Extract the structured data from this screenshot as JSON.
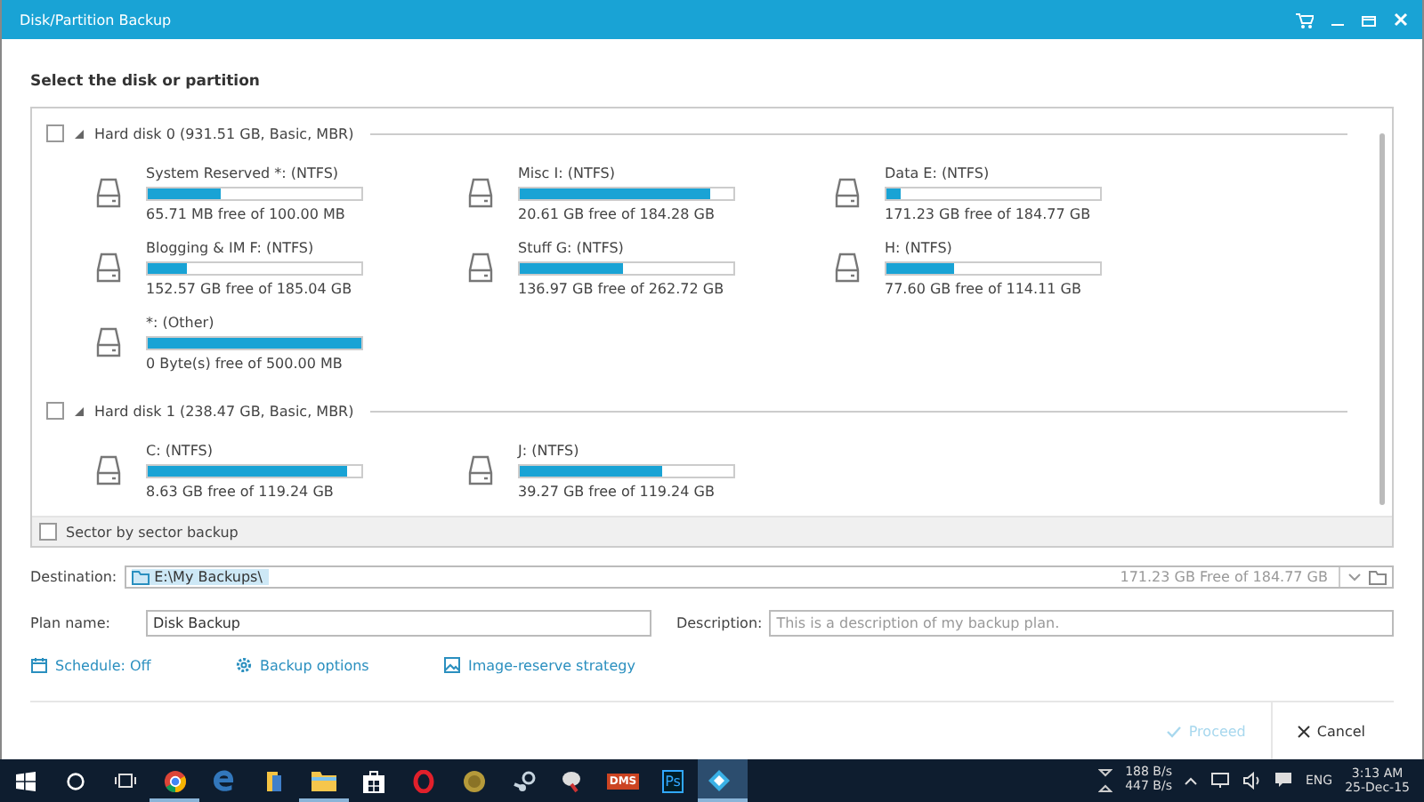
{
  "window": {
    "title": "Disk/Partition Backup"
  },
  "heading": "Select the disk or partition",
  "disks": [
    {
      "label": "Hard disk 0 (931.51 GB, Basic, MBR)",
      "checked": false,
      "expanded": true,
      "partitions": [
        {
          "name": "System Reserved *: (NTFS)",
          "level": 0.34,
          "free": "65.71 MB free of 100.00 MB"
        },
        {
          "name": "Misc I: (NTFS)",
          "level": 0.89,
          "free": "20.61 GB free of 184.28 GB"
        },
        {
          "name": "Data E: (NTFS)",
          "level": 0.07,
          "free": "171.23 GB free of 184.77 GB"
        },
        {
          "name": "Blogging & IM F: (NTFS)",
          "level": 0.18,
          "free": "152.57 GB free of 185.04 GB"
        },
        {
          "name": "Stuff G: (NTFS)",
          "level": 0.48,
          "free": "136.97 GB free of 262.72 GB"
        },
        {
          "name": "H: (NTFS)",
          "level": 0.32,
          "free": "77.60 GB free of 114.11 GB"
        },
        {
          "name": "*: (Other)",
          "level": 1.0,
          "free": "0 Byte(s) free of 500.00 MB"
        }
      ]
    },
    {
      "label": "Hard disk 1 (238.47 GB, Basic, MBR)",
      "checked": false,
      "expanded": true,
      "partitions": [
        {
          "name": "C: (NTFS)",
          "level": 0.93,
          "free": "8.63 GB free of 119.24 GB"
        },
        {
          "name": "J: (NTFS)",
          "level": 0.67,
          "free": "39.27 GB free of 119.24 GB"
        }
      ]
    }
  ],
  "sector_backup": {
    "label": "Sector by sector backup",
    "checked": false
  },
  "destination": {
    "label": "Destination:",
    "value": "E:\\My Backups\\",
    "free": "171.23 GB Free of 184.77 GB"
  },
  "plan_name": {
    "label": "Plan name:",
    "value": "Disk Backup"
  },
  "description": {
    "label": "Description:",
    "placeholder": "This is a description of my backup plan."
  },
  "links": [
    {
      "kind": "calendar",
      "label": "Schedule: Off"
    },
    {
      "kind": "gear",
      "label": "Backup options"
    },
    {
      "kind": "image",
      "label": "Image-reserve strategy"
    }
  ],
  "buttons": [
    {
      "label": "Proceed",
      "kind": "proceed",
      "disabled": true
    },
    {
      "label": "Cancel",
      "kind": "cancel",
      "disabled": false
    }
  ],
  "taskbar": {
    "items": [
      {
        "kind": "start",
        "open": false
      },
      {
        "kind": "search",
        "open": false
      },
      {
        "kind": "taskview",
        "open": false
      },
      {
        "kind": "chrome",
        "open": true
      },
      {
        "kind": "edge",
        "open": false
      },
      {
        "kind": "folder",
        "open": false
      },
      {
        "kind": "explorer",
        "open": true
      },
      {
        "kind": "store",
        "open": false
      },
      {
        "kind": "opera",
        "open": false
      },
      {
        "kind": "coin",
        "open": false
      },
      {
        "kind": "steam",
        "open": false
      },
      {
        "kind": "dish",
        "open": false
      },
      {
        "kind": "dms",
        "open": false,
        "label": "DMS"
      },
      {
        "kind": "ps",
        "open": false,
        "label": "Ps"
      },
      {
        "kind": "app",
        "open": true,
        "selected": true
      }
    ],
    "net_down": "188 B/s",
    "net_up": "447 B/s",
    "language": "ENG",
    "time": "3:13 AM",
    "date": "25-Dec-15"
  }
}
